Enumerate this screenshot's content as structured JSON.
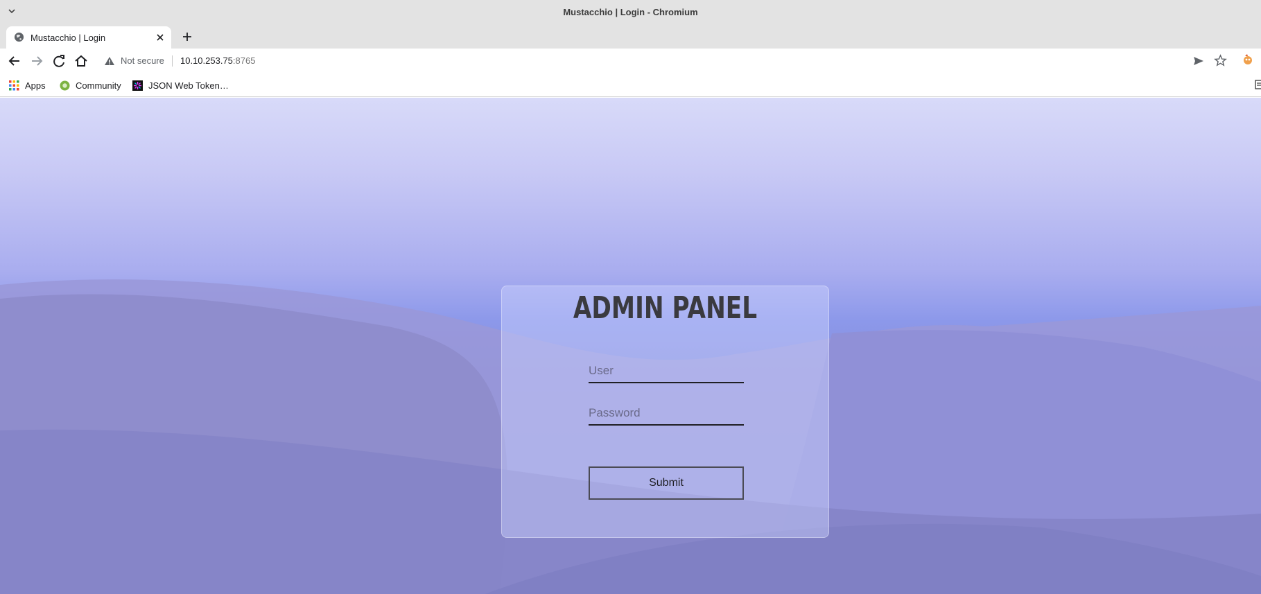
{
  "window": {
    "title": "Mustacchio | Login - Chromium"
  },
  "tabs": [
    {
      "title": "Mustacchio | Login"
    }
  ],
  "address_bar": {
    "security_label": "Not secure",
    "host": "10.10.253.75",
    "port": ":8765"
  },
  "bookmarks": [
    {
      "label": "Apps",
      "icon": "apps-grid-icon"
    },
    {
      "label": "Community",
      "icon": "community-icon"
    },
    {
      "label": "JSON Web Token…",
      "icon": "jwt-icon"
    }
  ],
  "login": {
    "heading": "ADMIN PANEL",
    "user_placeholder": "User",
    "password_placeholder": "Password",
    "submit_label": "Submit"
  }
}
